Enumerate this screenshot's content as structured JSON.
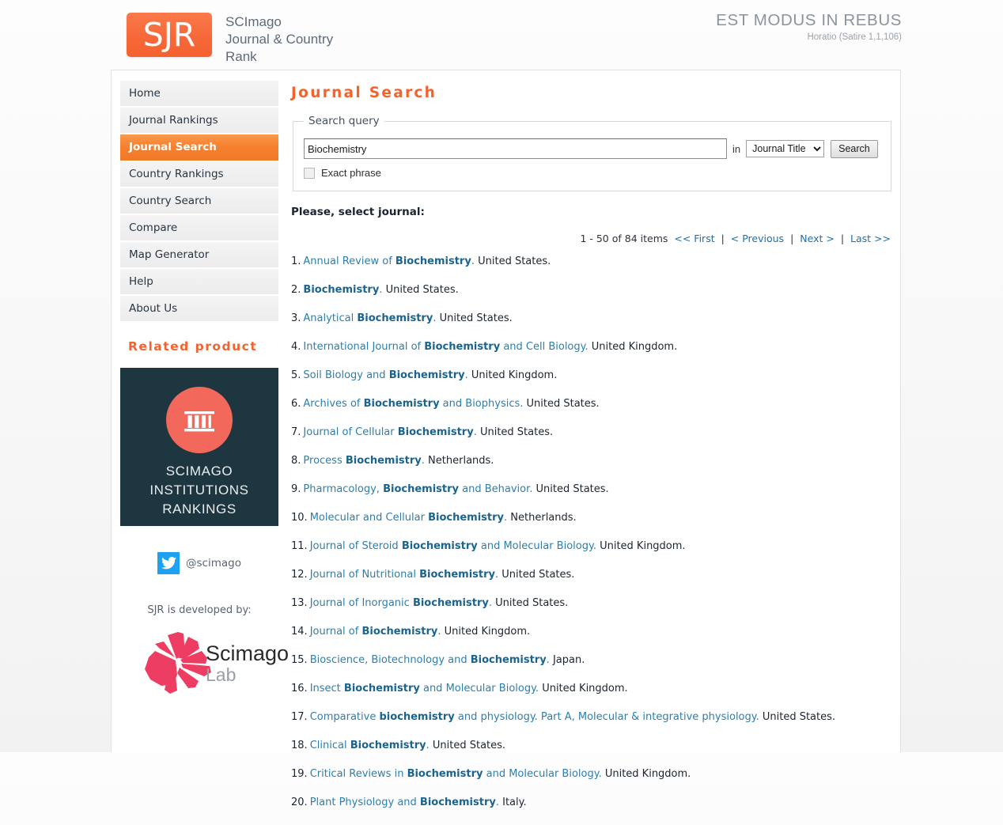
{
  "header": {
    "logo_text": "SJR",
    "brand_title": "SCImago\nJournal & Country\nRank",
    "motto": "EST MODUS IN REBUS",
    "motto_sub": "Horatio (Satire 1,1,106)"
  },
  "sidebar": {
    "items": [
      {
        "label": "Home",
        "active": false
      },
      {
        "label": "Journal Rankings",
        "active": false
      },
      {
        "label": "Journal Search",
        "active": true
      },
      {
        "label": "Country Rankings",
        "active": false
      },
      {
        "label": "Country Search",
        "active": false
      },
      {
        "label": "Compare",
        "active": false
      },
      {
        "label": "Map Generator",
        "active": false
      },
      {
        "label": "Help",
        "active": false
      },
      {
        "label": "About Us",
        "active": false
      }
    ],
    "related_product_title": "Related product",
    "banner": {
      "text": "SCIMAGO\nINSTITUTIONS\nRANKINGS",
      "icon": "classical-building-icon",
      "bg_color": "#1d3640",
      "circle_color": "#f2695c"
    },
    "twitter": {
      "icon": "twitter-icon",
      "handle": "@scimago",
      "color": "#1da1f2"
    },
    "developed_by_label": "SJR is developed by:",
    "lab_logo": {
      "word_1": "Scimago",
      "word_2": "Lab",
      "mark_color": "#ee3d62"
    }
  },
  "content": {
    "page_title": "Journal Search",
    "fieldset_legend": "Search query",
    "search": {
      "value": "Biochemistry",
      "placeholder": "",
      "in_label": "in",
      "field_selected": "Journal Title",
      "field_options": [
        "Journal Title"
      ],
      "search_button": "Search",
      "exact_phrase_label": "Exact phrase",
      "exact_phrase_checked": false
    },
    "select_prompt": "Please, select journal:",
    "pager": {
      "range_text": "1 - 50 of 84 items",
      "first": "<< First",
      "previous": "< Previous",
      "next": "Next >",
      "last": "Last >>",
      "separator": "|"
    },
    "results": [
      {
        "index": "1.",
        "title_html": "Annual Review of <b>Biochemistry</b>.",
        "country": "United States."
      },
      {
        "index": "2.",
        "title_html": "<b>Biochemistry</b>.",
        "country": "United States."
      },
      {
        "index": "3.",
        "title_html": "Analytical <b>Biochemistry</b>.",
        "country": "United States."
      },
      {
        "index": "4.",
        "title_html": "International Journal of <b>Biochemistry</b> and Cell Biology.",
        "country": "United Kingdom."
      },
      {
        "index": "5.",
        "title_html": "Soil Biology and <b>Biochemistry</b>.",
        "country": "United Kingdom."
      },
      {
        "index": "6.",
        "title_html": "Archives of <b>Biochemistry</b> and Biophysics.",
        "country": "United States."
      },
      {
        "index": "7.",
        "title_html": "Journal of Cellular <b>Biochemistry</b>.",
        "country": "United States."
      },
      {
        "index": "8.",
        "title_html": "Process <b>Biochemistry</b>.",
        "country": "Netherlands."
      },
      {
        "index": "9.",
        "title_html": "Pharmacology, <b>Biochemistry</b> and Behavior.",
        "country": "United States."
      },
      {
        "index": "10.",
        "title_html": "Molecular and Cellular <b>Biochemistry</b>.",
        "country": "Netherlands."
      },
      {
        "index": "11.",
        "title_html": "Journal of Steroid <b>Biochemistry</b> and Molecular Biology.",
        "country": "United Kingdom."
      },
      {
        "index": "12.",
        "title_html": "Journal of Nutritional <b>Biochemistry</b>.",
        "country": "United States."
      },
      {
        "index": "13.",
        "title_html": "Journal of Inorganic <b>Biochemistry</b>.",
        "country": "United States."
      },
      {
        "index": "14.",
        "title_html": "Journal of <b>Biochemistry</b>.",
        "country": "United Kingdom."
      },
      {
        "index": "15.",
        "title_html": "Bioscience, Biotechnology and <b>Biochemistry</b>.",
        "country": "Japan."
      },
      {
        "index": "16.",
        "title_html": "Insect <b>Biochemistry</b> and Molecular Biology.",
        "country": "United Kingdom."
      },
      {
        "index": "17.",
        "title_html": "Comparative <b>biochemistry</b> and physiology. Part A, Molecular &amp; integrative physiology.",
        "country": "United States."
      },
      {
        "index": "18.",
        "title_html": "Clinical <b>Biochemistry</b>.",
        "country": "United States."
      },
      {
        "index": "19.",
        "title_html": "Critical Reviews in <b>Biochemistry</b> and Molecular Biology.",
        "country": "United Kingdom."
      },
      {
        "index": "20.",
        "title_html": "Plant Physiology and <b>Biochemistry</b>.",
        "country": "Italy."
      }
    ]
  },
  "colors": {
    "accent_orange": "#f4622d",
    "link_blue": "#2b7fae",
    "pager_link": "#1f6fa8",
    "panel_bg": "#ffffff"
  }
}
